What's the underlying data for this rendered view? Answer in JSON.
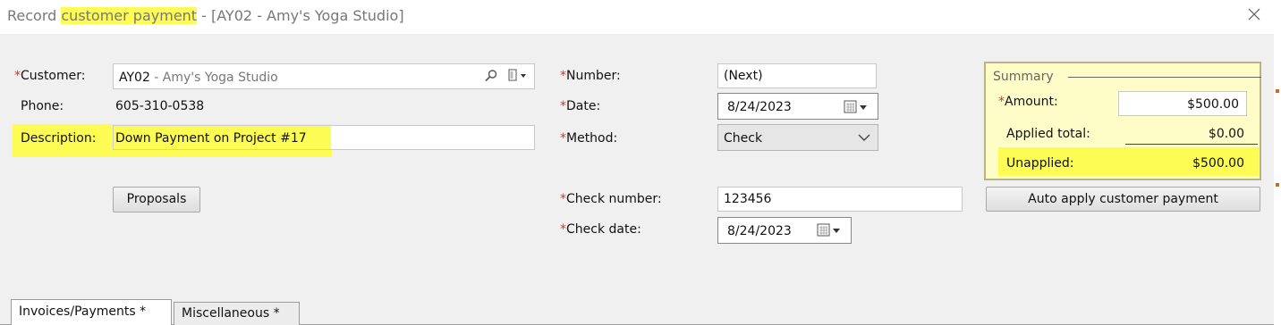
{
  "window": {
    "title_prefix": "Record ",
    "title_highlight": "customer payment",
    "title_suffix": " - [AY02 - Amy's Yoga Studio]"
  },
  "customer": {
    "label": "Customer:",
    "code": "AY02",
    "name": " - Amy's Yoga Studio"
  },
  "phone": {
    "label": "Phone:",
    "value": "605-310-0538"
  },
  "description": {
    "label": "Description:",
    "value": "Down Payment on Project #17"
  },
  "proposals_button": "Proposals",
  "number": {
    "label": "Number:",
    "value": "(Next)"
  },
  "date": {
    "label": "Date:",
    "value": "8/24/2023"
  },
  "method": {
    "label": "Method:",
    "value": "Check"
  },
  "check_number": {
    "label": "Check number:",
    "value": "123456"
  },
  "check_date": {
    "label": "Check date:",
    "value": "8/24/2023"
  },
  "summary": {
    "title": "Summary",
    "amount_label": "Amount:",
    "amount_value": "$500.00",
    "applied_label": "Applied total:",
    "applied_value": "$0.00",
    "unapplied_label": "Unapplied:",
    "unapplied_value": "$500.00"
  },
  "auto_apply_button": "Auto apply customer payment",
  "tabs": [
    {
      "label": "Invoices/Payments *",
      "active": true
    },
    {
      "label": "Miscellaneous *",
      "active": false
    }
  ],
  "required_marker": "*",
  "icons": [
    "close-icon",
    "search-icon",
    "lookup-menu-icon",
    "calendar-icon",
    "chevron-down-icon"
  ],
  "colors": {
    "highlight": "#fdfc54",
    "required": "#e0302a",
    "summary_bg": "#fefdc8"
  }
}
